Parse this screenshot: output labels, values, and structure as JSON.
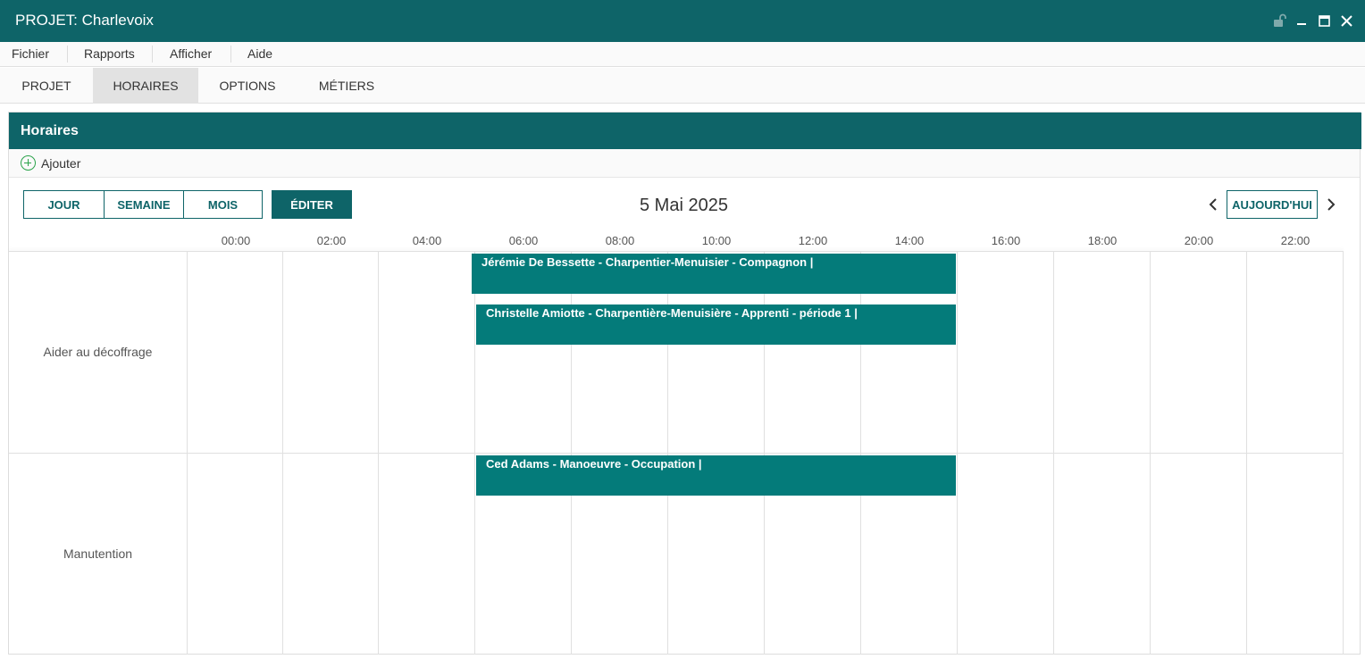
{
  "window": {
    "title": "PROJET: Charlevoix"
  },
  "menu": [
    "Fichier",
    "Rapports",
    "Afficher",
    "Aide"
  ],
  "tabs": [
    {
      "label": "PROJET",
      "active": false
    },
    {
      "label": "HORAIRES",
      "active": true
    },
    {
      "label": "OPTIONS",
      "active": false
    },
    {
      "label": "MÉTIERS",
      "active": false
    }
  ],
  "panel": {
    "title": "Horaires",
    "add_label": "Ajouter"
  },
  "toolbar": {
    "views": [
      "JOUR",
      "SEMAINE",
      "MOIS"
    ],
    "edit_label": "ÉDITER",
    "date": "5 Mai 2025",
    "today_label": "AUJOURD'HUI"
  },
  "hours": [
    "00:00",
    "02:00",
    "04:00",
    "06:00",
    "08:00",
    "10:00",
    "12:00",
    "14:00",
    "16:00",
    "18:00",
    "20:00",
    "22:00"
  ],
  "rows": [
    {
      "label": "Aider au décoffrage"
    },
    {
      "label": "Manutention"
    }
  ],
  "events": [
    {
      "row": 0,
      "label": "Jérémie De Bessette - Charpentier-Menuisier - Compagnon |"
    },
    {
      "row": 0,
      "label": "Christelle Amiotte - Charpentière-Menuisière - Apprenti - période 1 |"
    },
    {
      "row": 1,
      "label": "Ced Adams - Manoeuvre - Occupation |"
    }
  ],
  "colors": {
    "primary": "#0e6468",
    "event": "#047b7a",
    "add_icon": "#2aa34a"
  }
}
